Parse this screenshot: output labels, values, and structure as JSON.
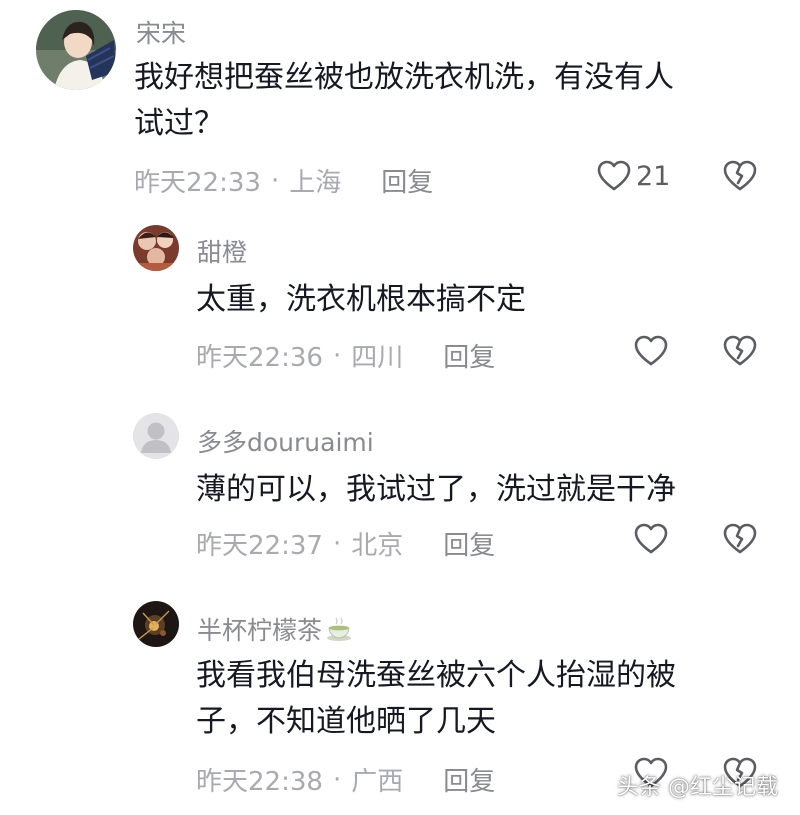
{
  "comments": [
    {
      "username": "宋宋",
      "text_line1": "我好想把蚕丝被也放洗衣机洗，有没有人",
      "text_line2": "试过？",
      "time": "昨天22:33",
      "separator": "·",
      "location": "上海",
      "reply_label": "回复",
      "like_count": "21"
    },
    {
      "username": "甜橙",
      "text_line1": "太重，洗衣机根本搞不定",
      "time": "昨天22:36",
      "separator": "·",
      "location": "四川",
      "reply_label": "回复"
    },
    {
      "username": "多多douruaimi",
      "text_line1": "薄的可以，我试过了，洗过就是干净",
      "time": "昨天22:37",
      "separator": "·",
      "location": "北京",
      "reply_label": "回复"
    },
    {
      "username": "半杯柠檬茶",
      "text_line1": "我看我伯母洗蚕丝被六个人抬湿的被",
      "text_line2": "子，不知道他晒了几天",
      "time": "昨天22:38",
      "separator": "·",
      "location": "广西",
      "reply_label": "回复"
    }
  ],
  "watermark": "头条 @红尘记载",
  "icons": {
    "like": "heart-outline-icon",
    "dislike": "broken-heart-icon",
    "username_emoji": "tea-cup-icon"
  },
  "colors": {
    "text": "#161823",
    "username": "#8a8b91",
    "meta": "#a9aab0",
    "icon_stroke": "#5c5d63"
  }
}
